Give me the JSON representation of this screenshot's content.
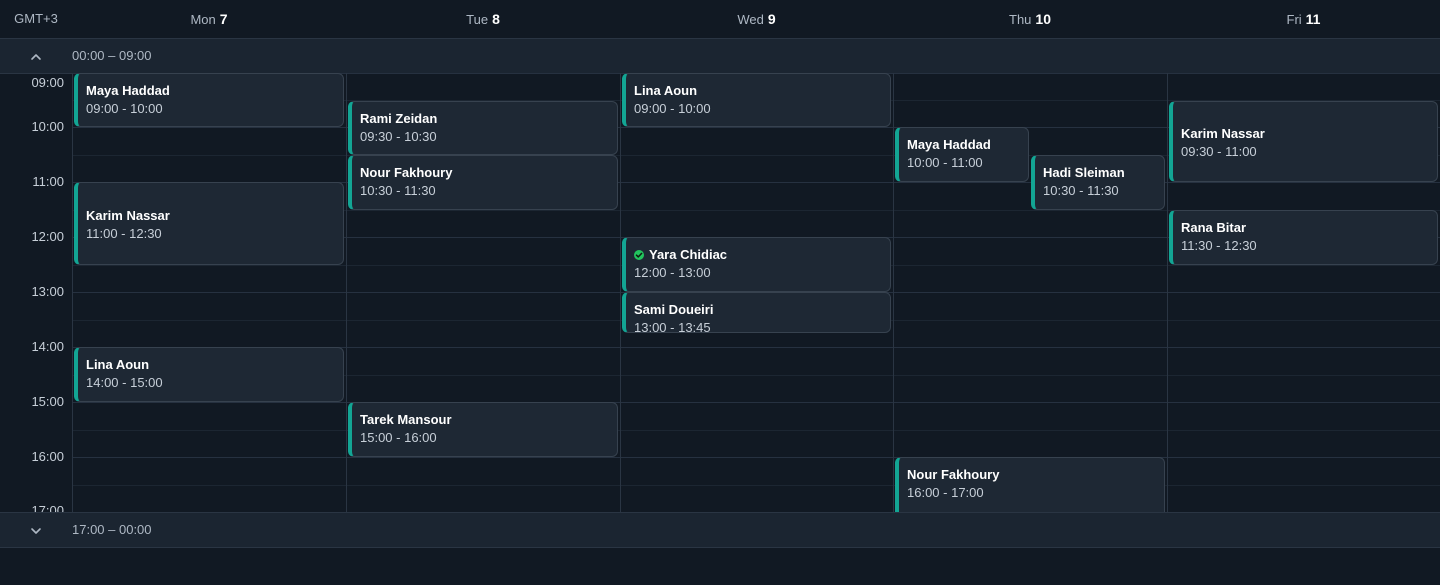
{
  "timezone": "GMT+3",
  "days": [
    {
      "name": "Mon",
      "num": "7"
    },
    {
      "name": "Tue",
      "num": "8"
    },
    {
      "name": "Wed",
      "num": "9"
    },
    {
      "name": "Thu",
      "num": "10"
    },
    {
      "name": "Fri",
      "num": "11"
    }
  ],
  "top_band": {
    "label": "00:00 – 09:00",
    "icon": "chevron-up-icon"
  },
  "bottom_band": {
    "label": "17:00 – 00:00",
    "icon": "chevron-down-icon"
  },
  "hours": [
    "09:00",
    "10:00",
    "11:00",
    "12:00",
    "13:00",
    "14:00",
    "15:00",
    "16:00",
    "17:00"
  ],
  "colors": {
    "accent": "#13a594",
    "confirmed": "#22c55e",
    "background": "#111923",
    "event_bg": "#1e2834"
  },
  "events": [
    {
      "day": 0,
      "name": "Maya Haddad",
      "time": "09:00 - 10:00"
    },
    {
      "day": 0,
      "name": "Karim Nassar",
      "time": "11:00 - 12:30"
    },
    {
      "day": 0,
      "name": "Lina Aoun",
      "time": "14:00 - 15:00"
    },
    {
      "day": 1,
      "name": "Rami Zeidan",
      "time": "09:30 - 10:30"
    },
    {
      "day": 1,
      "name": "Nour Fakhoury",
      "time": "10:30 - 11:30"
    },
    {
      "day": 1,
      "name": "Tarek Mansour",
      "time": "15:00 - 16:00"
    },
    {
      "day": 2,
      "name": "Lina Aoun",
      "time": "09:00 - 10:00"
    },
    {
      "day": 2,
      "name": "Yara Chidiac",
      "time": "12:00 - 13:00",
      "confirmed": true
    },
    {
      "day": 2,
      "name": "Sami Doueiri",
      "time": "13:00 - 13:45"
    },
    {
      "day": 3,
      "name": "Maya Haddad",
      "time": "10:00 - 11:00"
    },
    {
      "day": 3,
      "name": "Hadi Sleiman",
      "time": "10:30 - 11:30"
    },
    {
      "day": 3,
      "name": "Nour Fakhoury",
      "time": "16:00 - 17:00"
    },
    {
      "day": 4,
      "name": "Karim Nassar",
      "time": "09:30 - 11:00"
    },
    {
      "day": 4,
      "name": "Rana Bitar",
      "time": "11:30 - 12:30"
    }
  ]
}
